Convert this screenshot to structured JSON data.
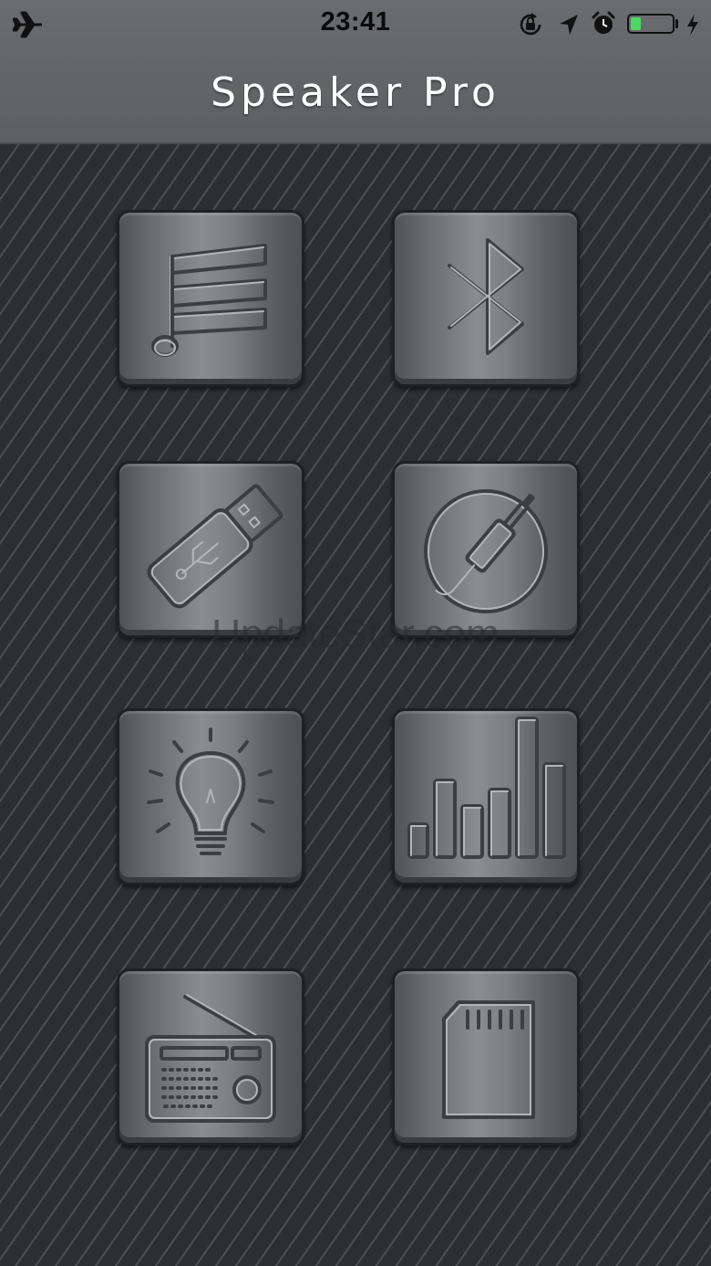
{
  "status_bar": {
    "time": "23:41",
    "icons": [
      "airplane-mode-icon",
      "rotation-lock-icon",
      "location-arrow-icon",
      "alarm-icon",
      "battery-icon",
      "charging-bolt-icon"
    ],
    "battery_level": 0.25,
    "battery_color": "#4cd964"
  },
  "header": {
    "title": "Speaker Pro"
  },
  "menu": {
    "tiles": [
      {
        "icon": "music-notes-icon"
      },
      {
        "icon": "bluetooth-icon"
      },
      {
        "icon": "usb-drive-icon"
      },
      {
        "icon": "aux-jack-icon"
      },
      {
        "icon": "light-bulb-icon"
      },
      {
        "icon": "equalizer-bars-icon"
      },
      {
        "icon": "radio-icon"
      },
      {
        "icon": "sd-card-icon"
      }
    ]
  },
  "watermark": "UpdateStar.com",
  "colors": {
    "header_bg": "#626467",
    "background": "#2e3235",
    "tile_face": "#7c7f82",
    "title_text": "#ffffff"
  }
}
